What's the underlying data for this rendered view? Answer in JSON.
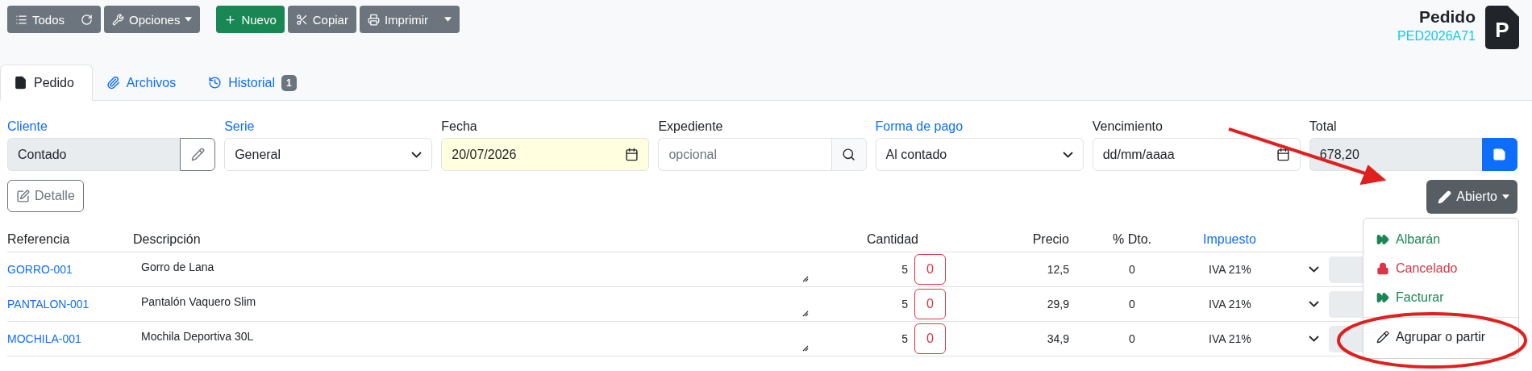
{
  "toolbar": [
    {
      "label": "Todos",
      "kind": "secondary",
      "caret": false
    },
    {
      "label": "Opciones",
      "kind": "secondary",
      "caret": true
    },
    {
      "label": "Nuevo",
      "kind": "success",
      "caret": false
    },
    {
      "label": "Copiar",
      "kind": "secondary",
      "caret": false
    },
    {
      "label": "Imprimir",
      "kind": "secondary",
      "caret": true
    }
  ],
  "header": {
    "title": "Pedido",
    "code": "PED2026A71",
    "badge": "P"
  },
  "tabs": [
    {
      "label": "Pedido",
      "selected": true
    },
    {
      "label": "Archivos",
      "selected": false
    },
    {
      "label": "Historial",
      "selected": false,
      "badge": "1"
    }
  ],
  "fields": [
    {
      "label": "Cliente",
      "link": true,
      "kind": "edit",
      "value": "Contado"
    },
    {
      "label": "Serie",
      "link": true,
      "kind": "select",
      "value": "General"
    },
    {
      "label": "Fecha",
      "link": false,
      "kind": "date",
      "value": "20/07/2026",
      "highlighted": true
    },
    {
      "label": "Expediente",
      "link": false,
      "kind": "search",
      "placeholder": "opcional"
    },
    {
      "label": "Forma de pago",
      "link": true,
      "kind": "select",
      "value": "Al contado"
    },
    {
      "label": "Vencimiento",
      "link": false,
      "kind": "date",
      "value": "dd/mm/aaaa",
      "highlighted": false
    },
    {
      "label": "Total",
      "link": false,
      "kind": "save",
      "value": "678,20"
    }
  ],
  "detail_button": "Detalle",
  "status_button": {
    "label": "Abierto",
    "expanded": true
  },
  "status_menu": [
    {
      "label": "Albarán",
      "kind": "forward",
      "color": "#198754",
      "divider_before": false
    },
    {
      "label": "Cancelado",
      "kind": "lock",
      "color": "#dc3545",
      "divider_before": false
    },
    {
      "label": "Facturar",
      "kind": "forward",
      "color": "#198754",
      "divider_before": false
    },
    {
      "label": "Agrupar o partir",
      "kind": "pencil",
      "color": "#212529",
      "divider_before": true
    }
  ],
  "table": {
    "columns": [
      {
        "label": "Referencia",
        "link": false
      },
      {
        "label": "Descripción",
        "link": false
      },
      {
        "label": "Cantidad",
        "link": false
      },
      {
        "label": "Precio",
        "link": false
      },
      {
        "label": "% Dto.",
        "link": false
      },
      {
        "label": "Impuesto",
        "link": true
      }
    ],
    "rows": [
      {
        "reference": "GORRO-001",
        "description": "Gorro de Lana",
        "quantity": "5",
        "served": "0",
        "price": "12,5",
        "discount": "0",
        "tax": "IVA 21%"
      },
      {
        "reference": "PANTALON-001",
        "description": "Pantalón Vaquero Slim",
        "quantity": "5",
        "served": "0",
        "price": "29,9",
        "discount": "0",
        "tax": "IVA 21%"
      },
      {
        "reference": "MOCHILA-001",
        "description": "Mochila Deportiva 30L",
        "quantity": "5",
        "served": "0",
        "price": "34,9",
        "discount": "0",
        "tax": "IVA 21%"
      }
    ]
  },
  "annotations": {
    "arrow": true,
    "ellipse": true
  }
}
